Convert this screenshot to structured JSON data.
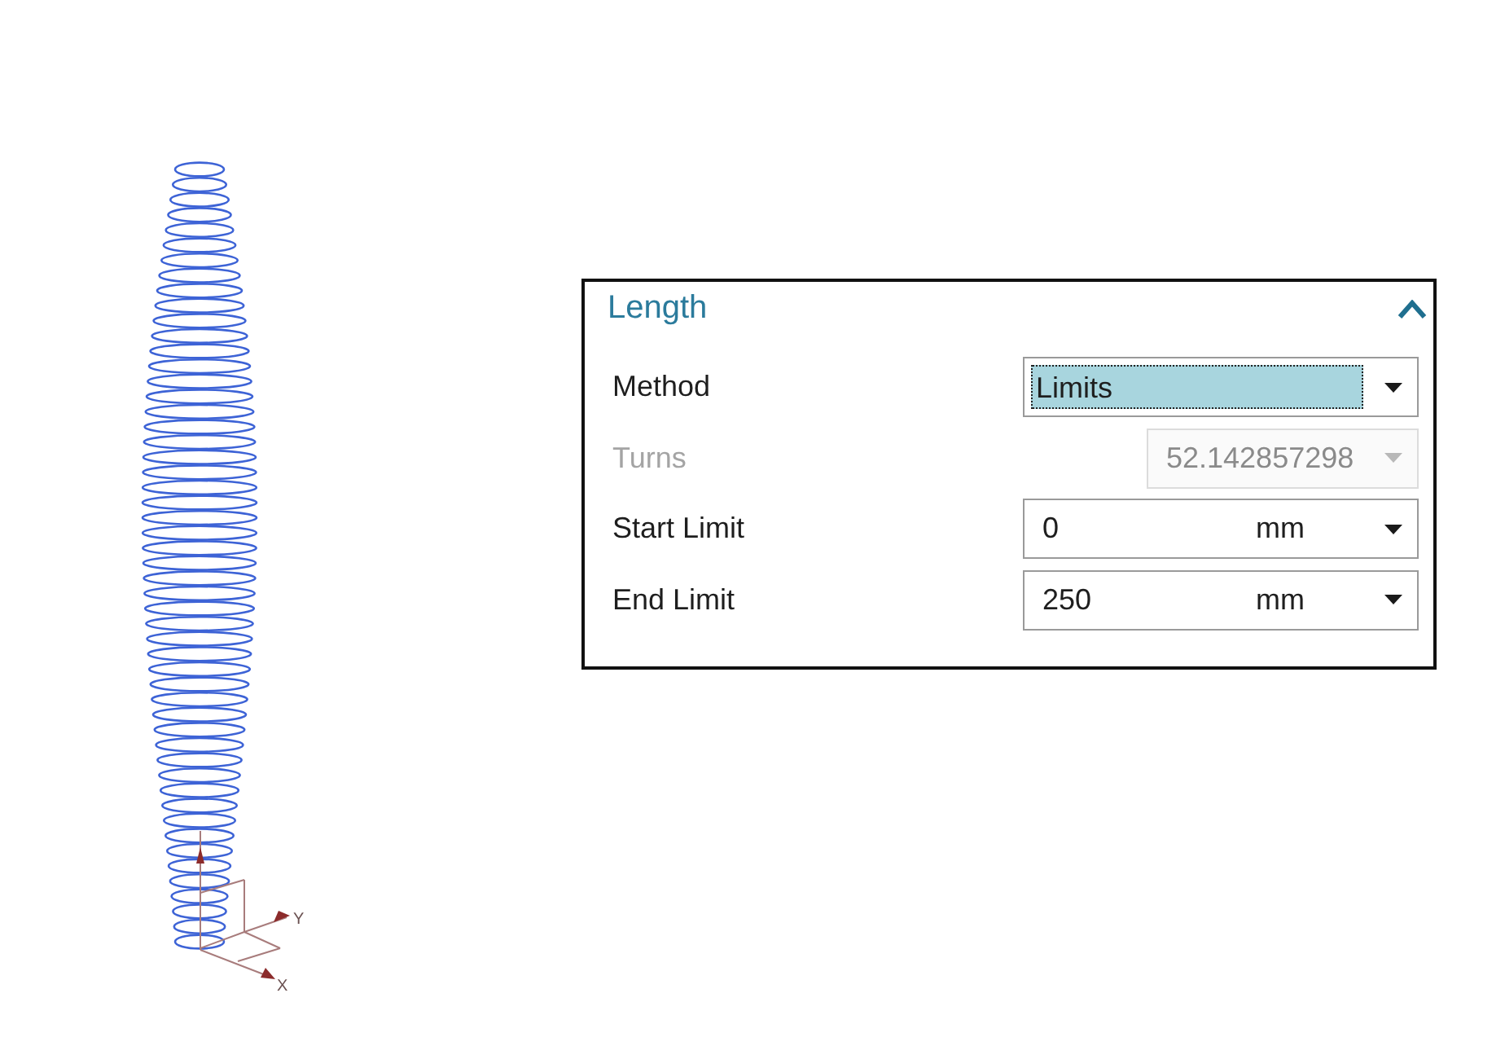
{
  "viewport": {
    "triad": {
      "y_label": "Y",
      "x_label": "X"
    }
  },
  "panel": {
    "title": "Length",
    "expanded": true,
    "fields": [
      {
        "kind": "dropdown",
        "label": "Method",
        "value": "Limits",
        "focused": true,
        "disabled": false
      },
      {
        "kind": "number",
        "label": "Turns",
        "value": "52.142857298",
        "focused": false,
        "disabled": true
      },
      {
        "kind": "measure",
        "label": "Start Limit",
        "value": "0",
        "unit": "mm",
        "focused": false,
        "disabled": false
      },
      {
        "kind": "measure",
        "label": "End Limit",
        "value": "250",
        "unit": "mm",
        "focused": false,
        "disabled": false
      }
    ]
  }
}
